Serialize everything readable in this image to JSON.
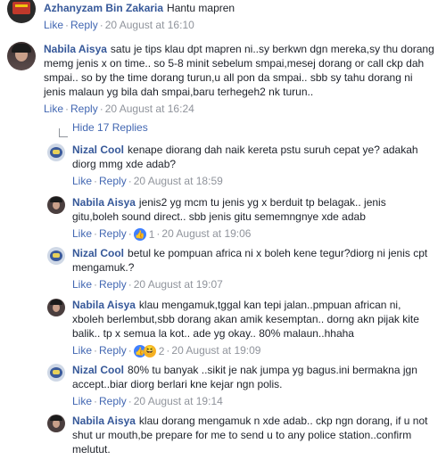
{
  "comments": [
    {
      "author": "Azhanyzam Bin Zakaria",
      "text": "Hantu mapren",
      "like": "Like",
      "reply": "Reply",
      "time": "20 August at 16:10"
    },
    {
      "author": "Nabila Aisya",
      "text": "satu je tips klau dpt mapren ni..sy berkwn dgn mereka,sy thu dorang memg jenis x on time.. so 5-8 minit sebelum smpai,mesej dorang or call ckp dah smpai.. so by the time dorang turun,u all pon da smpai.. sbb sy tahu dorang ni jenis malaun yg bila dah smpai,baru terhegeh2 nk turun..",
      "like": "Like",
      "reply": "Reply",
      "time": "20 August at 16:24"
    }
  ],
  "replies_toggle": "Hide 17 Replies",
  "replies": [
    {
      "author": "Nizal Cool",
      "text": "kenape diorang dah naik kereta pstu suruh cepat ye? adakah diorg mmg xde adab?",
      "like": "Like",
      "reply": "Reply",
      "time": "20 August at 18:59"
    },
    {
      "author": "Nabila Aisya",
      "text": "jenis2 yg mcm tu jenis yg x berduit tp belagak.. jenis gitu,boleh sound direct.. sbb jenis gitu sememngnye xde adab",
      "like": "Like",
      "reply": "Reply",
      "reaction_count": "1",
      "time": "20 August at 19:06"
    },
    {
      "author": "Nizal Cool",
      "text": "betul ke pompuan africa ni x boleh kene tegur?diorg ni jenis cpt mengamuk.?",
      "like": "Like",
      "reply": "Reply",
      "time": "20 August at 19:07"
    },
    {
      "author": "Nabila Aisya",
      "text": "klau mengamuk,tggal kan tepi jalan..pmpuan african ni, xboleh berlembut,sbb dorang akan amik kesemptan.. dorng akn pijak kite balik.. tp x semua la kot.. ade yg okay.. 80% malaun..hhaha",
      "like": "Like",
      "reply": "Reply",
      "reaction_count": "2",
      "time": "20 August at 19:09"
    },
    {
      "author": "Nizal Cool",
      "text": "80% tu banyak ..sikit je nak jumpa yg bagus.ini bermakna jgn accept..biar diorg berlari kne kejar ngn polis.",
      "like": "Like",
      "reply": "Reply",
      "time": "20 August at 19:14"
    },
    {
      "author": "Nabila Aisya",
      "text": "klau dorang mengamuk n xde adab.. ckp ngn dorang, if u not shut ur mouth,be prepare for me to send u to any police station..confirm melutut."
    }
  ],
  "colors": {
    "author_link": "#365899",
    "action_link": "#4267b2",
    "meta_gray": "#90949c",
    "like_reaction": "#4080ff",
    "haha_reaction": "#f7b125"
  }
}
